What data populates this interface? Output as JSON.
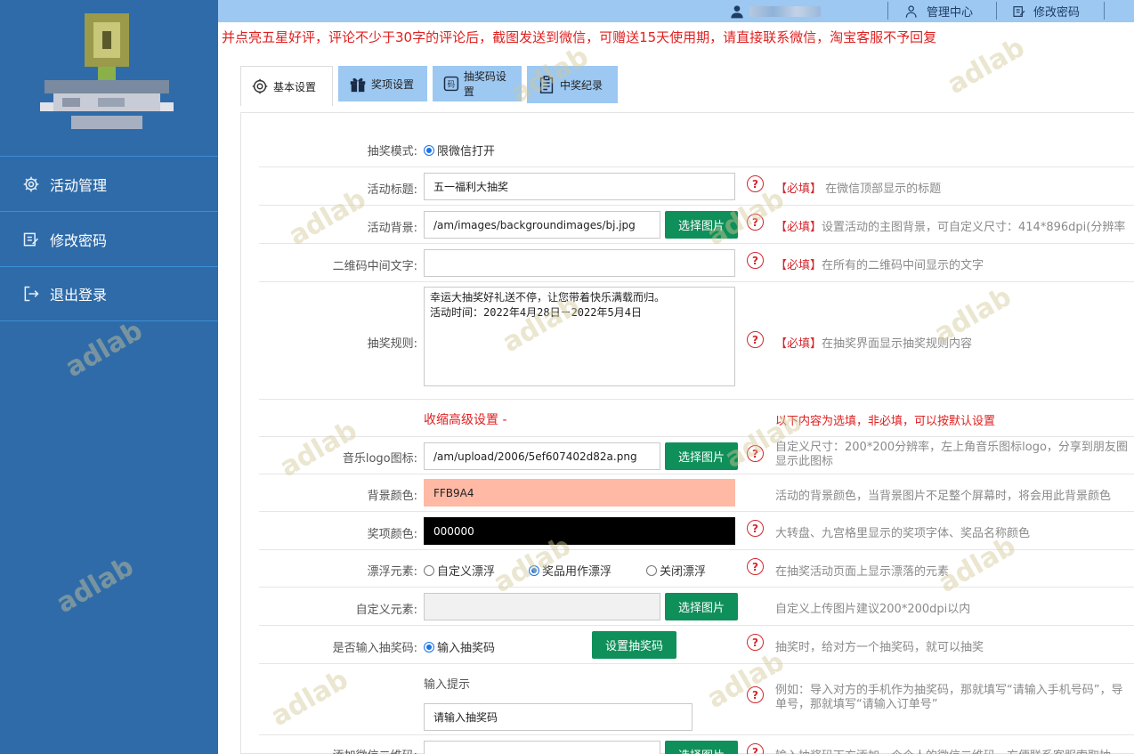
{
  "colors": {
    "sidebar": "#2f6ba8",
    "topbar": "#9cc8f2",
    "accent_green": "#0f8f5a",
    "required_red": "#d2282f",
    "bg_color_swatch": "#FFB9A4",
    "prize_color_swatch": "#000000"
  },
  "topbar": {
    "manage_center": "管理中心",
    "change_password": "修改密码"
  },
  "notice": "并点亮五星好评，评论不少于30字的评论后，截图发送到微信，可赠送15天使用期，请直接联系微信，淘宝客服不予回复",
  "sidebar": {
    "items": [
      {
        "icon": "gear-icon",
        "label": "活动管理"
      },
      {
        "icon": "edit-icon",
        "label": "修改密码"
      },
      {
        "icon": "logout-icon",
        "label": "退出登录"
      }
    ]
  },
  "tabs": [
    {
      "icon": "settings-icon",
      "label": "基本设置"
    },
    {
      "icon": "gift-icon",
      "label": "奖项设置"
    },
    {
      "icon": "code-icon",
      "label": "抽奖码设置"
    },
    {
      "icon": "clipboard-icon",
      "label": "中奖纪录"
    }
  ],
  "form": {
    "mode": {
      "label": "抽奖模式:",
      "option": "限微信打开"
    },
    "title": {
      "label": "活动标题:",
      "value": "五一福利大抽奖",
      "req": "【必填】",
      "hint": "在微信顶部显示的标题"
    },
    "background": {
      "label": "活动背景:",
      "value": "/am/images/backgroundimages/bj.jpg",
      "button": "选择图片",
      "req": "【必填】",
      "hint": "设置活动的主图背景，可自定义尺寸：414*896dpi(分辨率"
    },
    "qr_text": {
      "label": "二维码中间文字:",
      "value": "",
      "req": "【必填】",
      "hint": "在所有的二维码中间显示的文字"
    },
    "rules": {
      "label": "抽奖规则:",
      "value": "幸运大抽奖好礼送不停，让您带着快乐满载而归。\n活动时间：2022年4月28日－2022年5月4日",
      "req": "【必填】",
      "hint": "在抽奖界面显示抽奖规则内容"
    },
    "advanced": {
      "toggle": "收缩高级设置 -",
      "note": "以下内容为选填，非必填，可以按默认设置"
    },
    "music_logo": {
      "label": "音乐logo图标:",
      "value": "/am/upload/2006/5ef607402d82a.png",
      "button": "选择图片",
      "hint_line1": "自定义尺寸：200*200分辨率，左上角音乐图标logo，分享到朋友圈",
      "hint_line2": "显示此图标"
    },
    "bg_color": {
      "label": "背景颜色:",
      "value": "FFB9A4",
      "hint": "活动的背景颜色，当背景图片不足整个屏幕时，将会用此背景颜色"
    },
    "prize_color": {
      "label": "奖项颜色:",
      "value": "000000",
      "hint": "大转盘、九宫格里显示的奖项字体、奖品名称颜色"
    },
    "float": {
      "label": "漂浮元素:",
      "options": [
        "自定义漂浮",
        "奖品用作漂浮",
        "关闭漂浮"
      ],
      "hint": "在抽奖活动页面上显示漂落的元素"
    },
    "custom_elem": {
      "label": "自定义元素:",
      "button": "选择图片",
      "hint": "自定义上传图片建议200*200dpi以内"
    },
    "code_input": {
      "label": "是否输入抽奖码:",
      "option": "输入抽奖码",
      "button": "设置抽奖码",
      "hint": "抽奖时，给对方一个抽奖码，就可以抽奖"
    },
    "prompt": {
      "label": "输入提示",
      "value": "请输入抽奖码",
      "hint_line1": "例如：导入对方的手机作为抽奖码，那就填写“请输入手机号码”，导",
      "hint_line2": "单号，那就填写“请输入订单号”"
    },
    "wechat_qr": {
      "label": "添加微信二维码:",
      "button": "选择图片",
      "hint": "输入抽奖码下方添加一个个人的微信二维码，方便联系客服索取抽"
    }
  },
  "help_glyph": "?"
}
